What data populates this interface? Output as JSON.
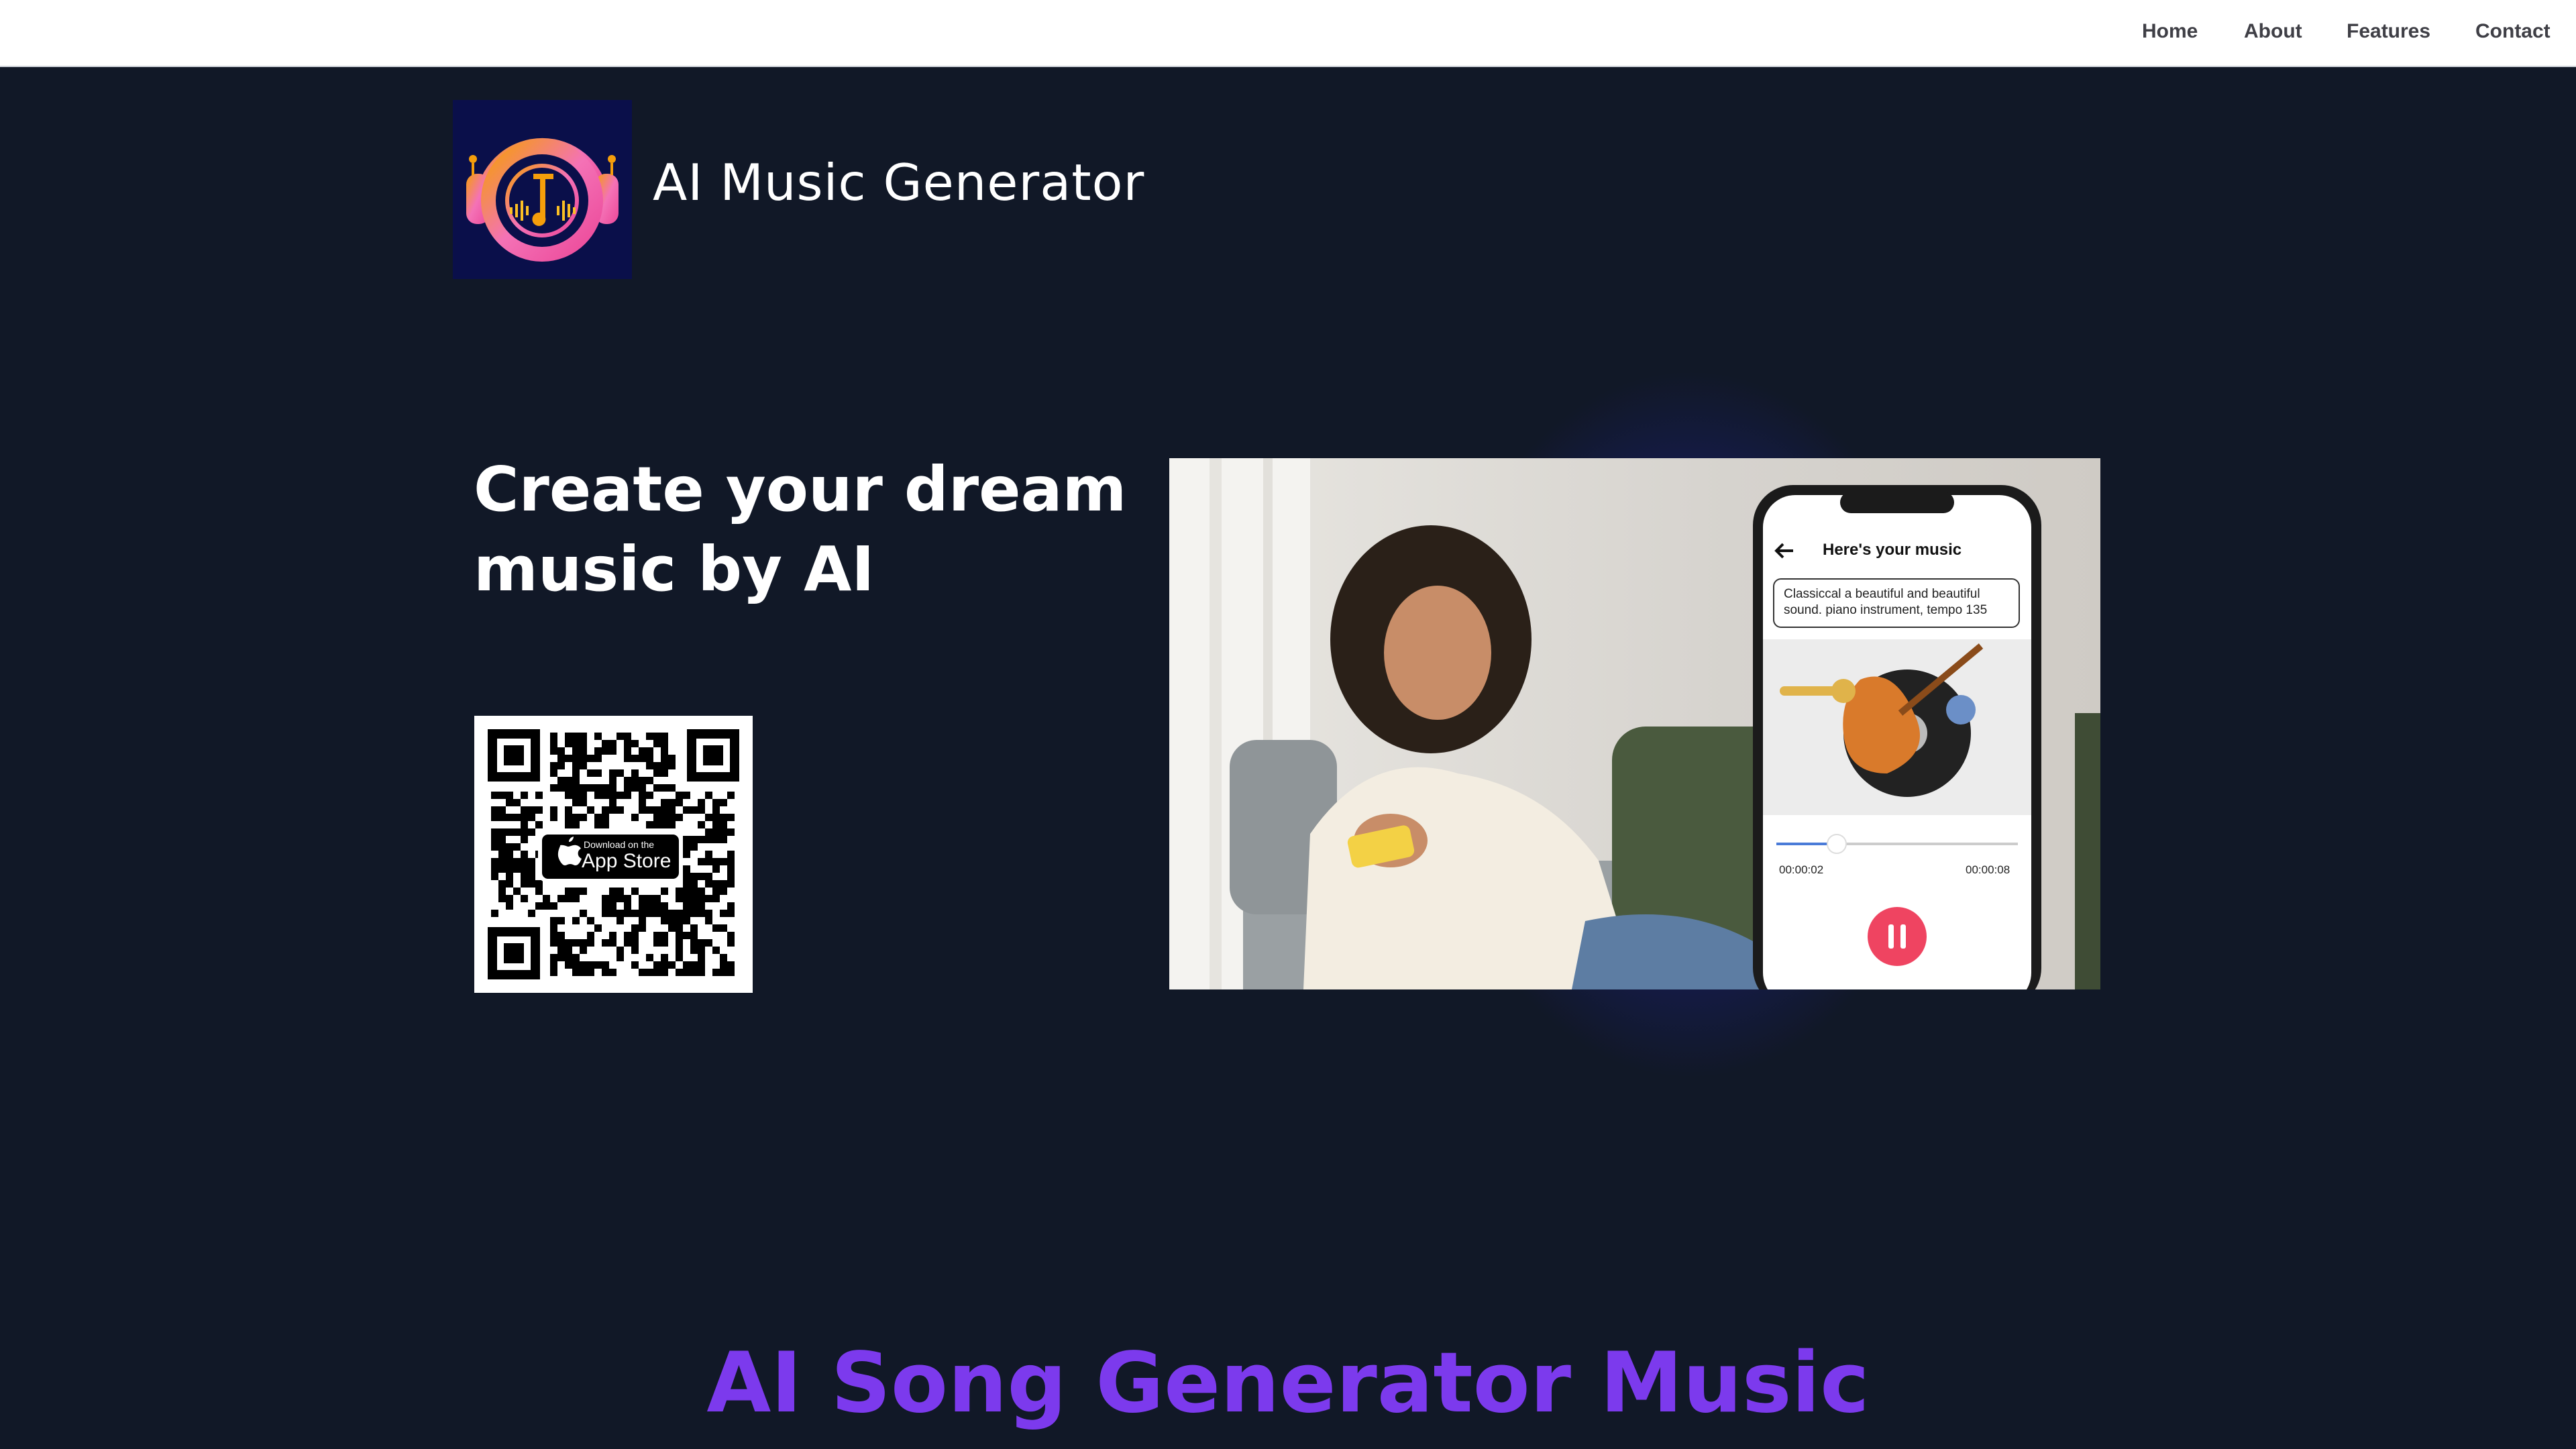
{
  "nav": {
    "items": [
      {
        "label": "Home"
      },
      {
        "label": "About"
      },
      {
        "label": "Features"
      },
      {
        "label": "Contact"
      }
    ]
  },
  "brand": {
    "name": "AI Music Generator",
    "logo_icon": "headphones-music-logo-icon"
  },
  "hero": {
    "title": "Create your dream music by AI",
    "qr_badge": {
      "small_text": "Download on the",
      "large_text": "App Store",
      "icon": "apple-icon"
    },
    "phone": {
      "title": "Here's your music",
      "prompt": "Classiccal a beautiful and beautiful sound. piano instrument, tempo 135",
      "time_elapsed": "00:00:02",
      "time_total": "00:00:08",
      "progress": 0.25,
      "pause_icon": "pause-icon",
      "back_icon": "back-arrow-icon"
    }
  },
  "section": {
    "title": "AI Song Generator Music"
  },
  "colors": {
    "background": "#111827",
    "accent_purple": "#7c3aed",
    "pause_button": "#ef4461",
    "glow_blue": "#3c46ff"
  }
}
